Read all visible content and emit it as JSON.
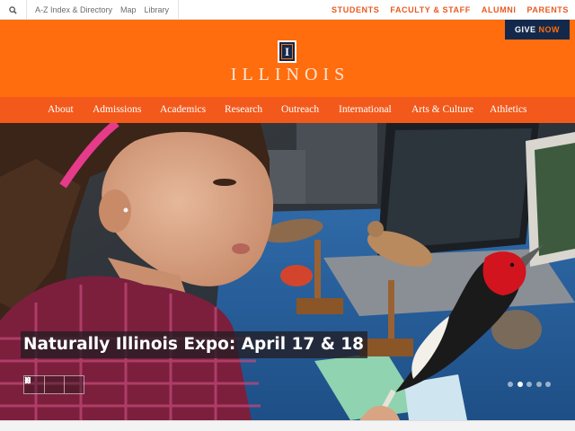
{
  "utility": {
    "links": [
      "A-Z Index & Directory",
      "Map",
      "Library"
    ],
    "audience_links": [
      "STUDENTS",
      "FACULTY & STAFF",
      "ALUMNI",
      "PARENTS"
    ]
  },
  "header": {
    "give_label_1": "GIVE",
    "give_label_2": "NOW",
    "logo_letter": "I",
    "wordmark": "ILLINOIS"
  },
  "nav": {
    "items": [
      "About",
      "Admissions",
      "Academics",
      "Research",
      "Outreach",
      "International",
      "Arts & Culture",
      "Athletics"
    ]
  },
  "hero": {
    "headline": "Naturally Illinois Expo: April 17 & 18",
    "slide_count": 5,
    "active_slide": 2
  },
  "colors": {
    "orange": "#ff6d0e",
    "nav_orange": "#f2591b",
    "navy": "#13294b"
  },
  "icons": [
    "search-icon",
    "previous-icon",
    "pause-icon",
    "next-icon"
  ]
}
